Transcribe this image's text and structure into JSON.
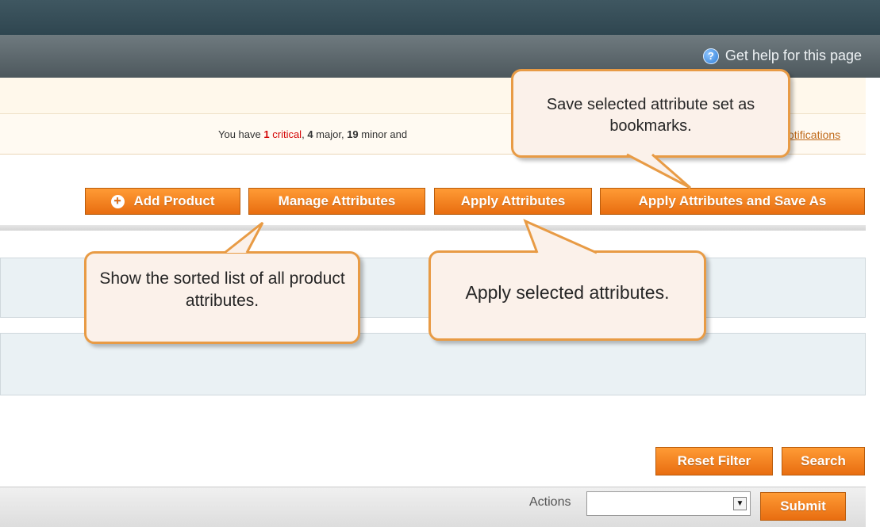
{
  "header": {
    "help_link": "Get help for this page",
    "help_icon": "help-circle-icon"
  },
  "notification": {
    "prefix": "You have",
    "critical_count": "1",
    "critical_label": "critical",
    "major_count": "4",
    "major_label": "major,",
    "minor_count": "19",
    "minor_label": "minor and",
    "view_link": "otifications"
  },
  "toolbar": {
    "add_product": "Add Product",
    "manage_attributes": "Manage Attributes",
    "apply_attributes": "Apply Attributes",
    "apply_save_as": "Apply Attributes and Save As"
  },
  "callouts": {
    "bookmark": "Save selected attribute set as bookmarks.",
    "sorted_list": "Show the sorted list of all product attributes.",
    "apply_selected": "Apply selected attributes."
  },
  "filters": {
    "reset_filter": "Reset Filter",
    "search": "Search"
  },
  "mass_actions": {
    "label": "Actions",
    "selected_value": "",
    "submit": "Submit"
  },
  "colors": {
    "button_orange": "#f07d1f",
    "callout_border": "#e89b45",
    "callout_fill": "#fbf1ea",
    "critical_red": "#d40707"
  }
}
